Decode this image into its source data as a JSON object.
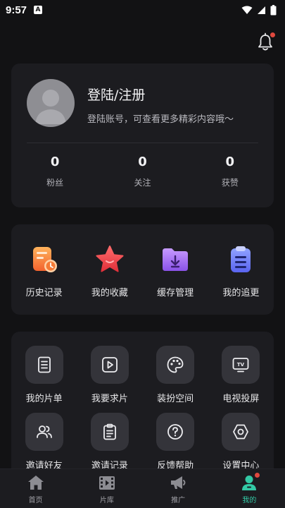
{
  "status_bar": {
    "time": "9:57",
    "notif_glyph": "A"
  },
  "header": {
    "bell_icon": "bell-icon",
    "has_badge": true
  },
  "profile": {
    "title": "登陆/注册",
    "subtitle": "登陆账号，可查看更多精彩内容哦～",
    "stats": [
      {
        "value": "0",
        "label": "粉丝"
      },
      {
        "value": "0",
        "label": "关注"
      },
      {
        "value": "0",
        "label": "获赞"
      }
    ]
  },
  "quick_actions": [
    {
      "label": "历史记录",
      "icon": "history-icon"
    },
    {
      "label": "我的收藏",
      "icon": "star-icon"
    },
    {
      "label": "缓存管理",
      "icon": "folder-download-icon"
    },
    {
      "label": "我的追更",
      "icon": "clipboard-icon"
    }
  ],
  "services": [
    {
      "label": "我的片单",
      "icon": "list-doc-icon"
    },
    {
      "label": "我要求片",
      "icon": "play-icon"
    },
    {
      "label": "装扮空间",
      "icon": "palette-icon"
    },
    {
      "label": "电视投屏",
      "icon": "tv-icon"
    },
    {
      "label": "邀请好友",
      "icon": "users-icon"
    },
    {
      "label": "邀请记录",
      "icon": "clipboard-icon"
    },
    {
      "label": "反馈帮助",
      "icon": "help-icon"
    },
    {
      "label": "设置中心",
      "icon": "settings-hex-icon"
    }
  ],
  "tabs": [
    {
      "label": "首页",
      "icon": "home-icon",
      "active": false
    },
    {
      "label": "片库",
      "icon": "film-icon",
      "active": false
    },
    {
      "label": "推广",
      "icon": "megaphone-icon",
      "active": false
    },
    {
      "label": "我的",
      "icon": "profile-icon",
      "active": true
    }
  ],
  "colors": {
    "background": "#121214",
    "card": "#1c1c20",
    "accent": "#33c9a5",
    "badge": "#e0483e"
  }
}
